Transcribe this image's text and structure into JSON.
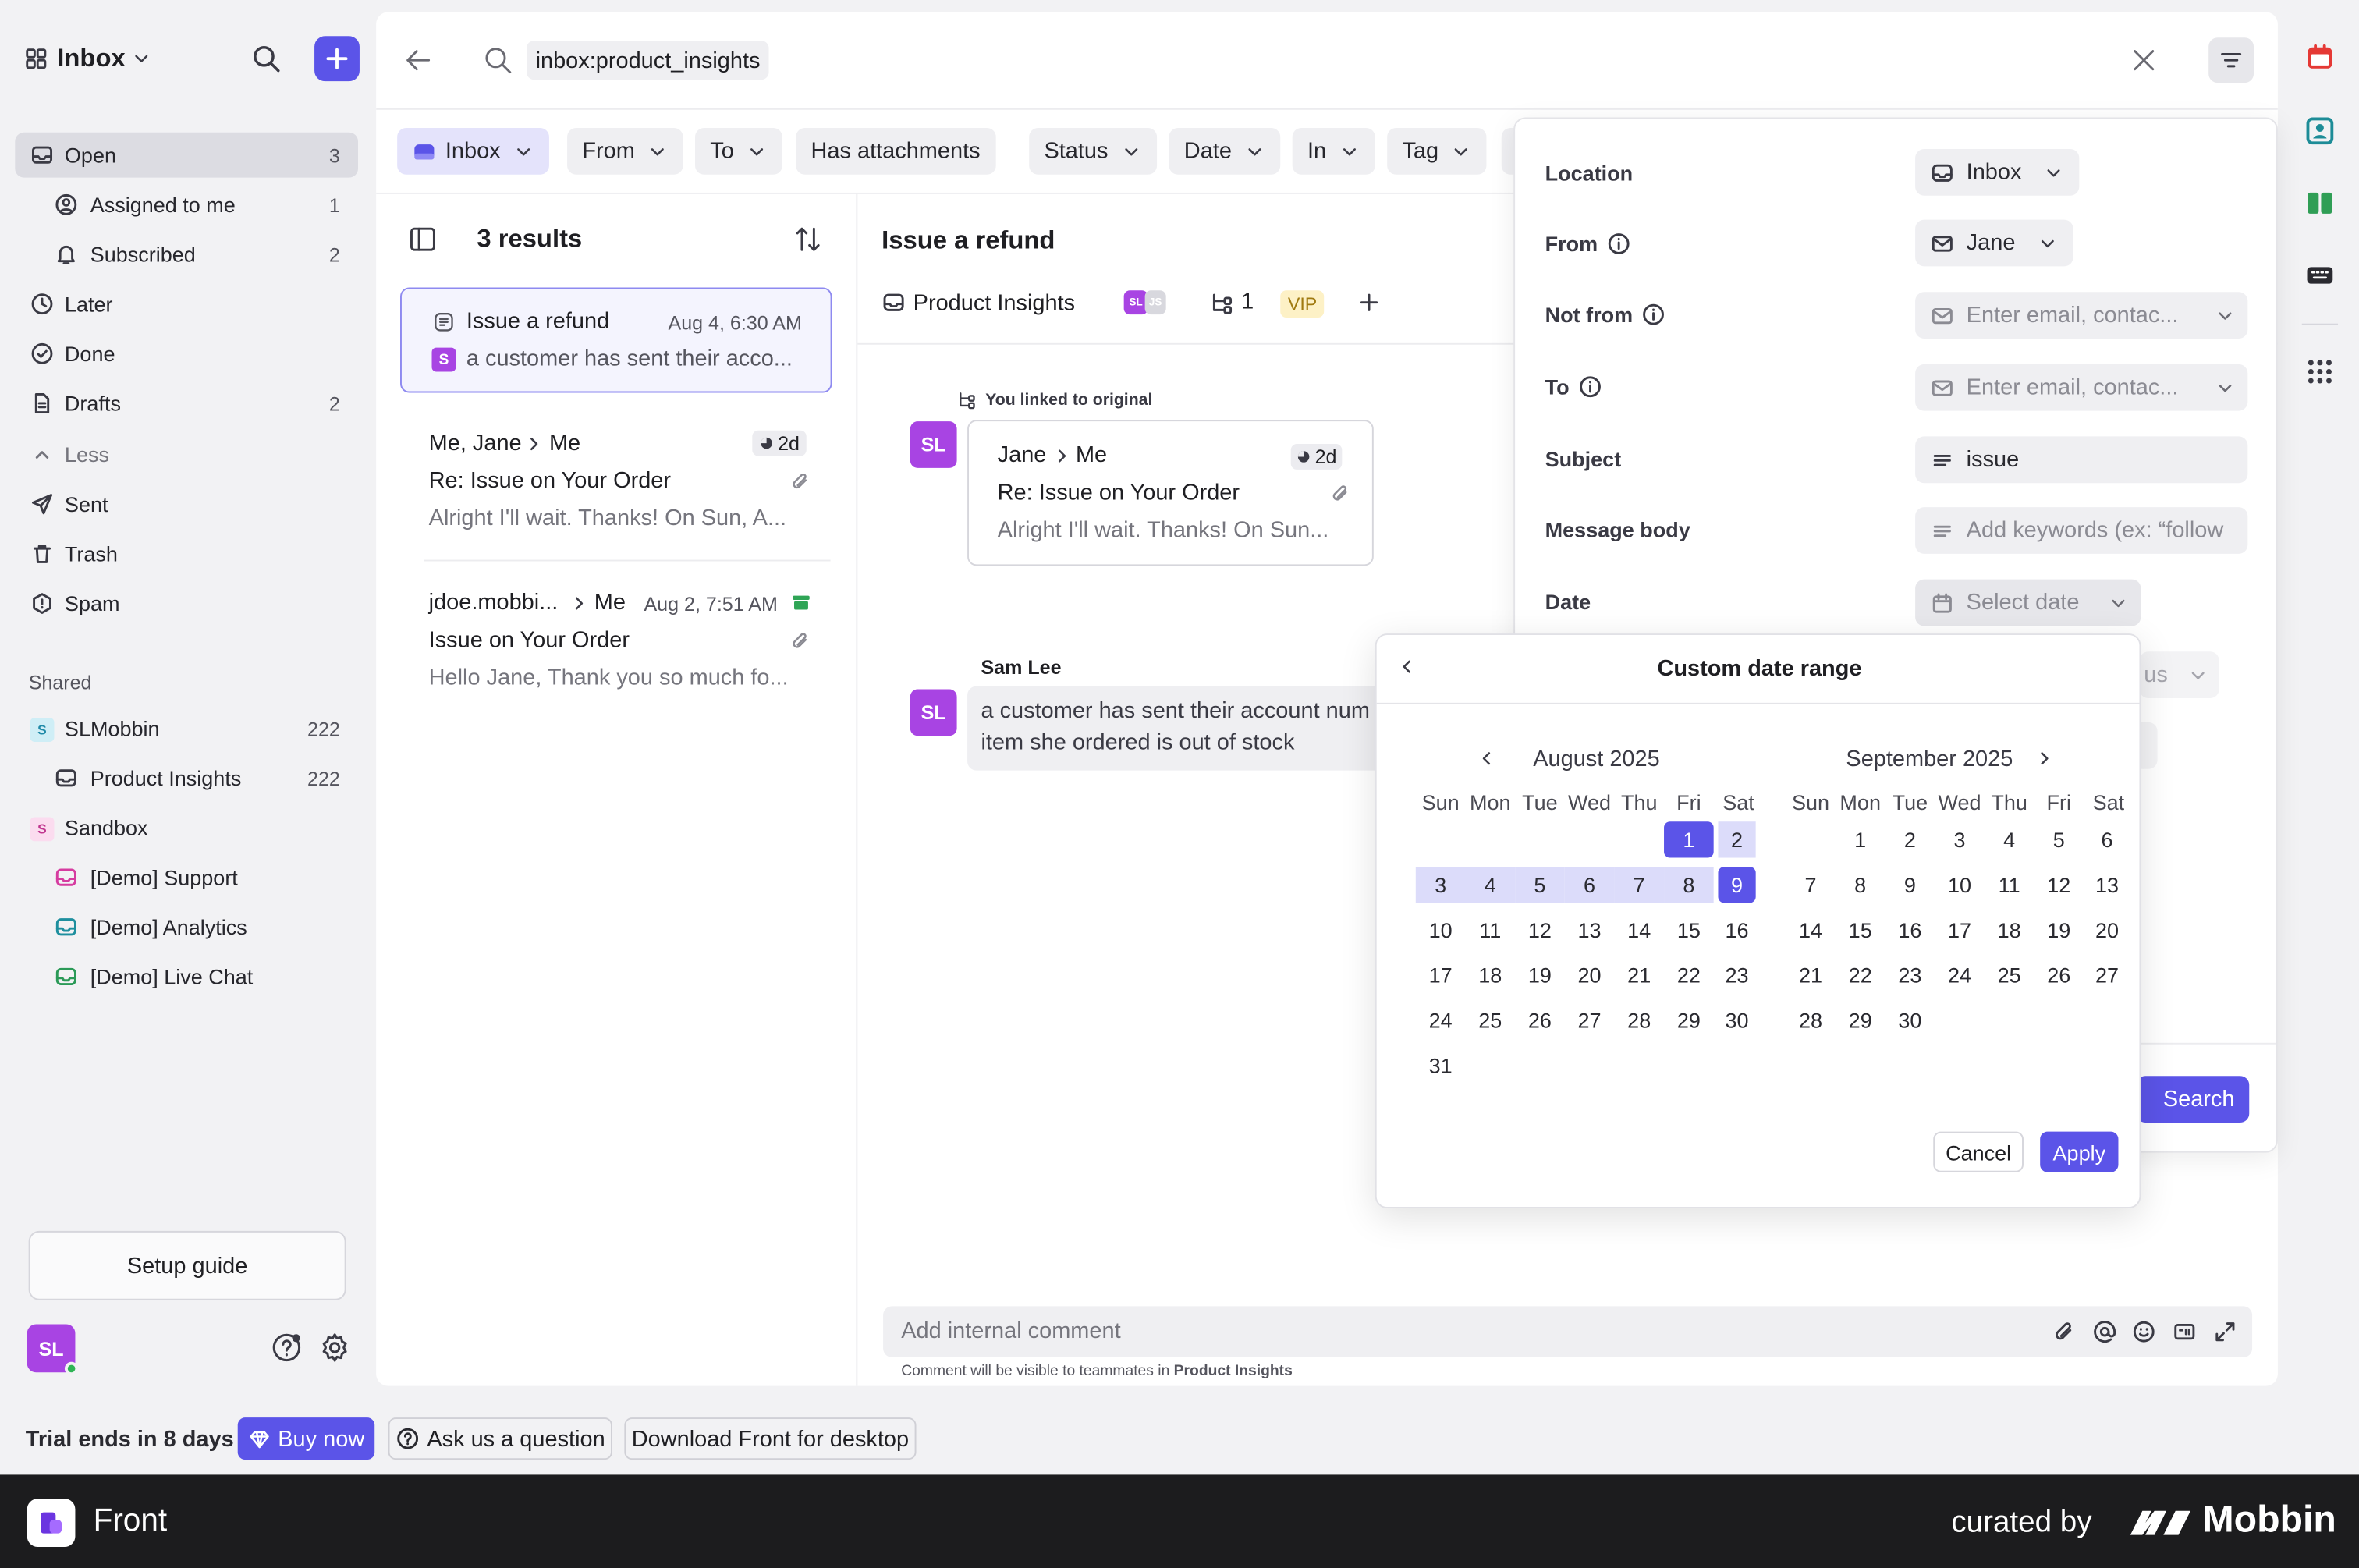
{
  "sidebar": {
    "title": "Inbox",
    "items": [
      {
        "label": "Open",
        "count": "3"
      },
      {
        "label": "Assigned to me",
        "count": "1"
      },
      {
        "label": "Subscribed",
        "count": "2"
      },
      {
        "label": "Later",
        "count": ""
      },
      {
        "label": "Done",
        "count": ""
      },
      {
        "label": "Drafts",
        "count": "2"
      },
      {
        "label": "Less",
        "count": ""
      },
      {
        "label": "Sent",
        "count": ""
      },
      {
        "label": "Trash",
        "count": ""
      },
      {
        "label": "Spam",
        "count": ""
      }
    ],
    "shared_heading": "Shared",
    "shared": [
      {
        "label": "SLMobbin",
        "count": "222",
        "badge": "S"
      },
      {
        "label": "Product Insights",
        "count": "222"
      },
      {
        "label": "Sandbox",
        "count": "",
        "badge": "S"
      },
      {
        "label": "[Demo] Support",
        "count": ""
      },
      {
        "label": "[Demo] Analytics",
        "count": ""
      },
      {
        "label": "[Demo] Live Chat",
        "count": ""
      }
    ],
    "setup_guide": "Setup guide",
    "avatar": "SL"
  },
  "search": {
    "query": "inbox:product_insights"
  },
  "filter_chips": [
    "Inbox",
    "From",
    "To",
    "Has attachments",
    "Status",
    "Date",
    "In",
    "Tag"
  ],
  "results": {
    "count_label": "3 results",
    "items": [
      {
        "subject": "Issue a refund",
        "time": "Aug 4, 6:30 AM",
        "preview": "a customer has sent their acco...",
        "badge": "S"
      },
      {
        "from": "Me, Jane",
        "to": "Me",
        "age": "2d",
        "subject": "Re: Issue on Your Order",
        "preview": "Alright I'll wait. Thanks! On Sun, A..."
      },
      {
        "from": "jdoe.mobbi...",
        "to": "Me",
        "time": "Aug 2, 7:51 AM",
        "subject": "Issue on Your Order",
        "preview": "Hello Jane, Thank you so much fo..."
      }
    ]
  },
  "conversation": {
    "title": "Issue a refund",
    "inbox": "Product Insights",
    "avatars": [
      "SL",
      "JS"
    ],
    "link_count": "1",
    "tag": "VIP",
    "linked_note": "You linked to original",
    "linked_card": {
      "from": "Jane",
      "to": "Me",
      "age": "2d",
      "subject": "Re: Issue on Your Order",
      "preview": "Alright I'll wait. Thanks! On Sun..."
    },
    "message": {
      "author": "Sam Lee",
      "avatar": "SL",
      "line1": "a customer has sent their account num",
      "line2": "item she ordered is out of stock"
    },
    "comment_placeholder": "Add internal comment",
    "comment_note_prefix": "Comment will be visible to teammates in",
    "comment_note_target": "Product Insights"
  },
  "filter_panel": {
    "location_label": "Location",
    "location_value": "Inbox",
    "from_label": "From",
    "from_value": "Jane",
    "not_from_label": "Not from",
    "not_from_placeholder": "Enter email, contac...",
    "to_label": "To",
    "to_placeholder": "Enter email, contac...",
    "subject_label": "Subject",
    "subject_value": "issue",
    "body_label": "Message body",
    "body_placeholder": "Add keywords (ex: “follow",
    "date_label": "Date",
    "date_placeholder": "Select date",
    "hidden_value": "us",
    "search_button": "Search"
  },
  "date_picker": {
    "title": "Custom date range",
    "weekdays": [
      "Sun",
      "Mon",
      "Tue",
      "Wed",
      "Thu",
      "Fri",
      "Sat"
    ],
    "months": [
      {
        "label": "August 2025",
        "first_weekday": 5,
        "days": 31
      },
      {
        "label": "September 2025",
        "first_weekday": 1,
        "days": 30
      }
    ],
    "range_start": 1,
    "range_end": 9,
    "cancel": "Cancel",
    "apply": "Apply"
  },
  "trial": {
    "text": "Trial ends in 8 days",
    "buy": "Buy now",
    "ask": "Ask us a question",
    "download": "Download Front for desktop"
  },
  "footer": {
    "app": "Front",
    "curated": "curated by",
    "brand": "Mobbin"
  },
  "colors": {
    "accent": "#5b54e8",
    "range": "#dcdcfa",
    "footer": "#1c1c1e"
  }
}
